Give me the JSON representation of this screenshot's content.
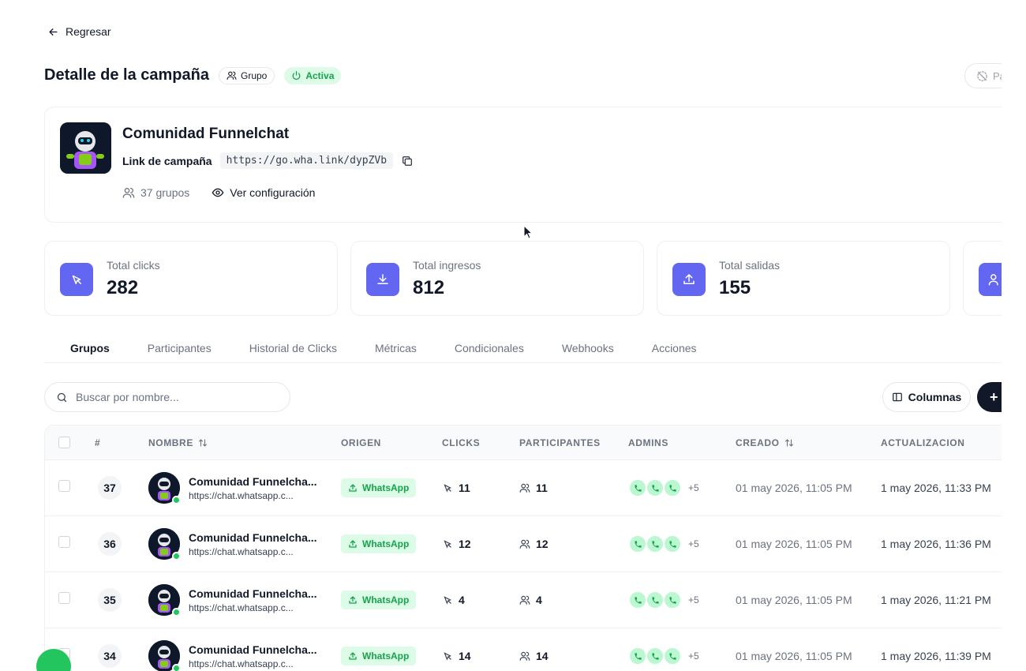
{
  "nav": {
    "back_label": "Regresar"
  },
  "header": {
    "title": "Detalle de la campaña",
    "type_badge": "Grupo",
    "status_badge": "Activa",
    "pause_label": "Pa"
  },
  "campaign": {
    "name": "Comunidad Funnelchat",
    "link_label": "Link de campaña",
    "link_url": "https://go.wha.link/dypZVb",
    "groups_count": "37 grupos",
    "view_config": "Ver configuración"
  },
  "stats": [
    {
      "label": "Total clicks",
      "value": "282",
      "icon": "cursor-click-icon"
    },
    {
      "label": "Total ingresos",
      "value": "812",
      "icon": "download-icon"
    },
    {
      "label": "Total salidas",
      "value": "155",
      "icon": "upload-icon"
    }
  ],
  "tabs": [
    "Grupos",
    "Participantes",
    "Historial de Clicks",
    "Métricas",
    "Condicionales",
    "Webhooks",
    "Acciones"
  ],
  "toolbar": {
    "search_placeholder": "Buscar por nombre...",
    "columns_label": "Columnas",
    "add_label": "+"
  },
  "table": {
    "headers": {
      "num": "#",
      "name": "NOMBRE",
      "origin": "ORIGEN",
      "clicks": "CLICKS",
      "participants": "PARTICIPANTES",
      "admins": "ADMINS",
      "created": "CREADO",
      "updated": "ACTUALIZACION"
    },
    "rows": [
      {
        "num": "37",
        "name": "Comunidad Funnelcha...",
        "url": "https://chat.whatsapp.c...",
        "origin": "WhatsApp",
        "clicks": "11",
        "participants": "11",
        "admins_more": "+5",
        "created": "01 may 2026, 11:05 PM",
        "updated": "1 may 2026, 11:33 PM"
      },
      {
        "num": "36",
        "name": "Comunidad Funnelcha...",
        "url": "https://chat.whatsapp.c...",
        "origin": "WhatsApp",
        "clicks": "12",
        "participants": "12",
        "admins_more": "+5",
        "created": "01 may 2026, 11:05 PM",
        "updated": "1 may 2026, 11:36 PM"
      },
      {
        "num": "35",
        "name": "Comunidad Funnelcha...",
        "url": "https://chat.whatsapp.c...",
        "origin": "WhatsApp",
        "clicks": "4",
        "participants": "4",
        "admins_more": "+5",
        "created": "01 may 2026, 11:05 PM",
        "updated": "1 may 2026, 11:21 PM"
      },
      {
        "num": "34",
        "name": "Comunidad Funnelcha...",
        "url": "https://chat.whatsapp.c...",
        "origin": "WhatsApp",
        "clicks": "14",
        "participants": "14",
        "admins_more": "+5",
        "created": "01 may 2026, 11:05 PM",
        "updated": "1 may 2026, 11:39 PM"
      }
    ]
  },
  "colors": {
    "accent": "#6366f1",
    "success": "#22c55e",
    "success_bg": "#dcfce7",
    "text": "#111827",
    "muted": "#6b7280"
  }
}
